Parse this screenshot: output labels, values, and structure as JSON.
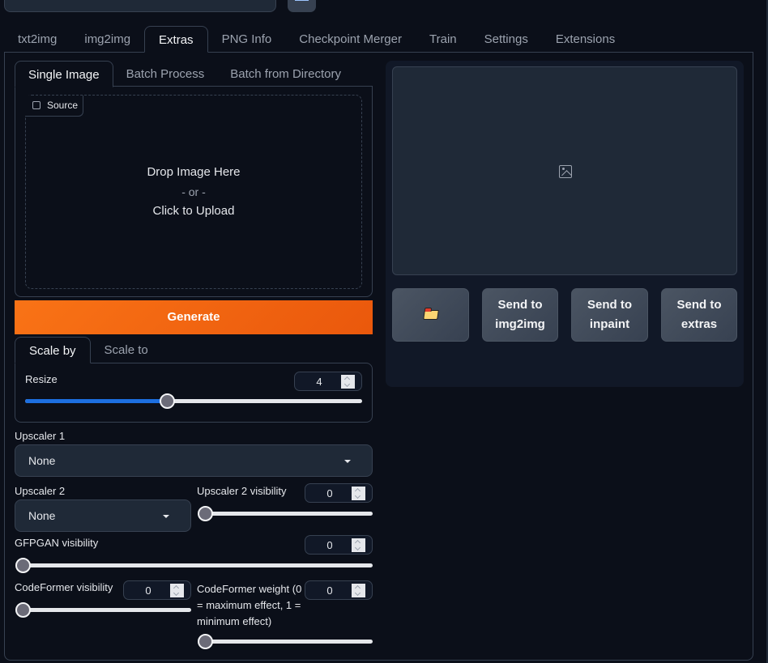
{
  "main_tabs": [
    {
      "label": "txt2img",
      "active": false
    },
    {
      "label": "img2img",
      "active": false
    },
    {
      "label": "Extras",
      "active": true
    },
    {
      "label": "PNG Info",
      "active": false
    },
    {
      "label": "Checkpoint Merger",
      "active": false
    },
    {
      "label": "Train",
      "active": false
    },
    {
      "label": "Settings",
      "active": false
    },
    {
      "label": "Extensions",
      "active": false
    }
  ],
  "sub_tabs": [
    {
      "label": "Single Image",
      "active": true
    },
    {
      "label": "Batch Process",
      "active": false
    },
    {
      "label": "Batch from Directory",
      "active": false
    }
  ],
  "source": {
    "label": "Source",
    "icon": "image-icon",
    "drop_text": "Drop Image Here",
    "or_text": "- or -",
    "upload_text": "Click to Upload"
  },
  "generate_label": "Generate",
  "colors": {
    "accent_orange": "#f97316",
    "slider_blue": "#1d6fe0",
    "background": "#0b0f19",
    "panel": "#1f2937"
  },
  "scale_tabs": [
    {
      "label": "Scale by",
      "active": true
    },
    {
      "label": "Scale to",
      "active": false
    }
  ],
  "resize": {
    "label": "Resize",
    "value": "4",
    "slider_fraction": 0.42
  },
  "upscaler1": {
    "label": "Upscaler 1",
    "value": "None"
  },
  "upscaler2": {
    "label": "Upscaler 2",
    "value": "None"
  },
  "upscaler2_visibility": {
    "label": "Upscaler 2 visibility",
    "value": "0",
    "slider_fraction": 0
  },
  "gfpgan_visibility": {
    "label": "GFPGAN visibility",
    "value": "0",
    "slider_fraction": 0
  },
  "codeformer_visibility": {
    "label": "CodeFormer visibility",
    "value": "0",
    "slider_fraction": 0
  },
  "codeformer_weight": {
    "label": "CodeFormer weight (0 = maximum effect, 1 = minimum effect)",
    "value": "0",
    "slider_fraction": 0
  },
  "output": {
    "placeholder_icon": "image-icon",
    "buttons": [
      {
        "label": "",
        "icon": "folder-icon"
      },
      {
        "label": "Send to img2img"
      },
      {
        "label": "Send to inpaint"
      },
      {
        "label": "Send to extras"
      }
    ]
  }
}
